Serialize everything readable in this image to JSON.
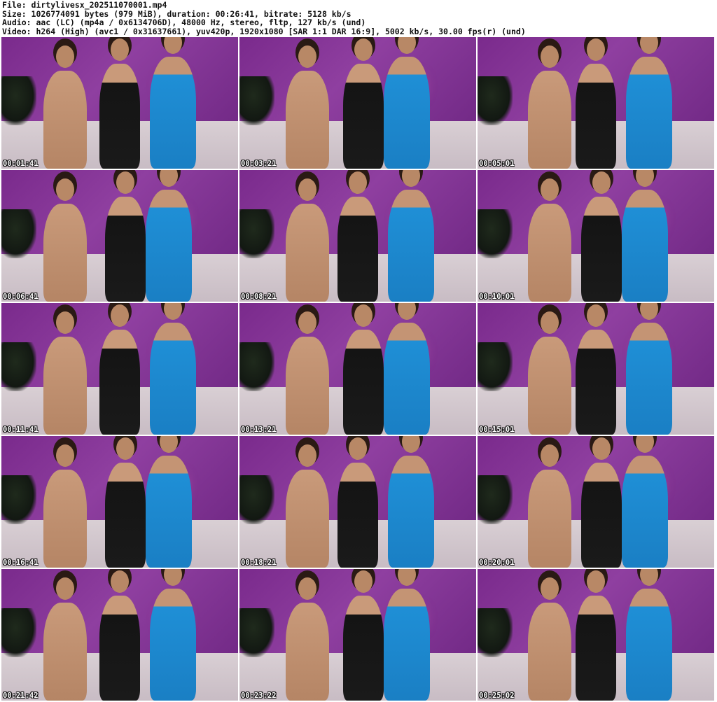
{
  "header": {
    "line1": "File: dirtylivesx_202511070001.mp4",
    "line2": "Size: 1026774091 bytes (979 MiB), duration: 00:26:41, bitrate: 5128 kb/s",
    "line3": "Audio: aac (LC) (mp4a / 0x6134706D), 48000 Hz, stereo, fltp, 127 kb/s (und)",
    "line4": "Video: h264 (High) (avc1 / 0x31637661), yuv420p, 1920x1080 [SAR 1:1 DAR 16:9], 5002 kb/s, 30.00 fps(r) (und)"
  },
  "thumbnails": [
    {
      "timestamp": "00:01:41"
    },
    {
      "timestamp": "00:03:21"
    },
    {
      "timestamp": "00:05:01"
    },
    {
      "timestamp": "00:06:41"
    },
    {
      "timestamp": "00:08:21"
    },
    {
      "timestamp": "00:10:01"
    },
    {
      "timestamp": "00:11:41"
    },
    {
      "timestamp": "00:13:21"
    },
    {
      "timestamp": "00:15:01"
    },
    {
      "timestamp": "00:16:41"
    },
    {
      "timestamp": "00:18:21"
    },
    {
      "timestamp": "00:20:01"
    },
    {
      "timestamp": "00:21:42"
    },
    {
      "timestamp": "00:23:22"
    },
    {
      "timestamp": "00:25:02"
    }
  ]
}
